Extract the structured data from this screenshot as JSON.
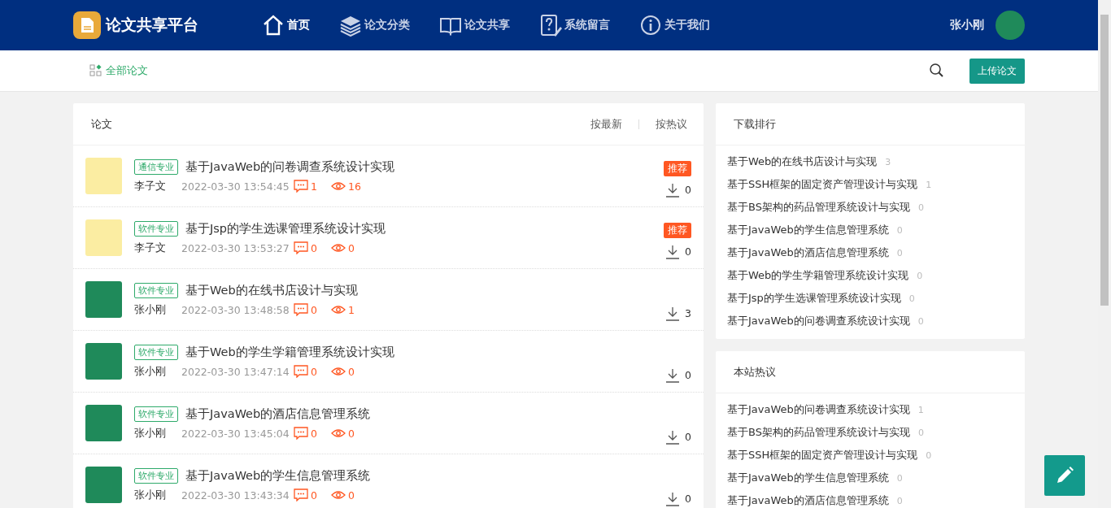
{
  "header": {
    "logo_text": "论文共享平台",
    "nav": [
      {
        "label": "首页",
        "selected": true
      },
      {
        "label": "论文分类",
        "selected": false
      },
      {
        "label": "论文共享",
        "selected": false
      },
      {
        "label": "系统留言",
        "selected": false
      },
      {
        "label": "关于我们",
        "selected": false
      }
    ],
    "user": {
      "name": "张小刚"
    }
  },
  "subbar": {
    "category": "全部论文",
    "upload_button": "上传论文"
  },
  "papers": {
    "title": "论文",
    "sorts": [
      {
        "label": "按最新",
        "selected": false
      },
      {
        "label": "按热议",
        "selected": false
      }
    ],
    "rows": [
      {
        "kind": "pig",
        "tag": "通信专业",
        "title": "基于JavaWeb的问卷调查系统设计实现",
        "author": "李子文",
        "time": "2022-03-30 13:54:45",
        "comments": "1",
        "views": "16",
        "recommended": true,
        "recommend_label": "推荐",
        "downloads": "0"
      },
      {
        "kind": "pig",
        "tag": "软件专业",
        "title": "基于Jsp的学生选课管理系统设计实现",
        "author": "李子文",
        "time": "2022-03-30 13:53:27",
        "comments": "0",
        "views": "0",
        "recommended": true,
        "recommend_label": "推荐",
        "downloads": "0"
      },
      {
        "kind": "girl",
        "tag": "软件专业",
        "title": "基于Web的在线书店设计与实现",
        "author": "张小刚",
        "time": "2022-03-30 13:48:58",
        "comments": "0",
        "views": "1",
        "recommended": false,
        "downloads": "3"
      },
      {
        "kind": "girl",
        "tag": "软件专业",
        "title": "基于Web的学生学籍管理系统设计实现",
        "author": "张小刚",
        "time": "2022-03-30 13:47:14",
        "comments": "0",
        "views": "0",
        "recommended": false,
        "downloads": "0"
      },
      {
        "kind": "girl",
        "tag": "软件专业",
        "title": "基于JavaWeb的酒店信息管理系统",
        "author": "张小刚",
        "time": "2022-03-30 13:45:04",
        "comments": "0",
        "views": "0",
        "recommended": false,
        "downloads": "0"
      },
      {
        "kind": "girl",
        "tag": "软件专业",
        "title": "基于JavaWeb的学生信息管理系统",
        "author": "张小刚",
        "time": "2022-03-30 13:43:34",
        "comments": "0",
        "views": "0",
        "recommended": false,
        "downloads": "0"
      }
    ]
  },
  "sidebar": [
    {
      "title": "下载排行",
      "items": [
        {
          "title": "基于Web的在线书店设计与实现",
          "count": "3"
        },
        {
          "title": "基于SSH框架的固定资产管理设计与实现",
          "count": "1"
        },
        {
          "title": "基于BS架构的药品管理系统设计与实现",
          "count": "0"
        },
        {
          "title": "基于JavaWeb的学生信息管理系统",
          "count": "0"
        },
        {
          "title": "基于JavaWeb的酒店信息管理系统",
          "count": "0"
        },
        {
          "title": "基于Web的学生学籍管理系统设计实现",
          "count": "0"
        },
        {
          "title": "基于Jsp的学生选课管理系统设计实现",
          "count": "0"
        },
        {
          "title": "基于JavaWeb的问卷调查系统设计实现",
          "count": "0"
        }
      ]
    },
    {
      "title": "本站热议",
      "items": [
        {
          "title": "基于JavaWeb的问卷调查系统设计实现",
          "count": "1"
        },
        {
          "title": "基于BS架构的药品管理系统设计与实现",
          "count": "0"
        },
        {
          "title": "基于SSH框架的固定资产管理设计与实现",
          "count": "0"
        },
        {
          "title": "基于JavaWeb的学生信息管理系统",
          "count": "0"
        },
        {
          "title": "基于JavaWeb的酒店信息管理系统",
          "count": "0"
        }
      ]
    }
  ]
}
